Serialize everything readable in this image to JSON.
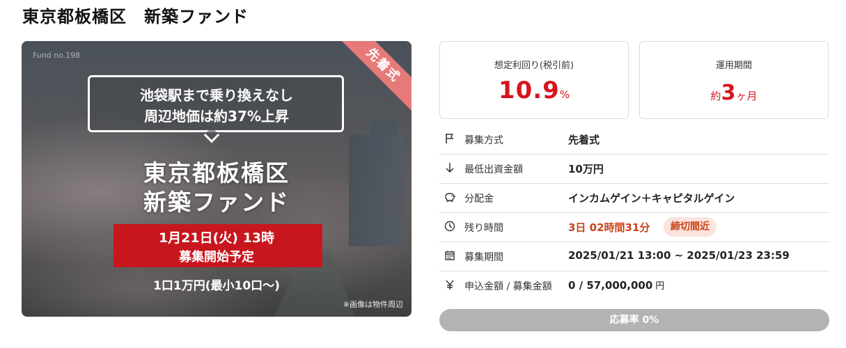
{
  "page": {
    "title": "東京都板橋区　新築ファンド"
  },
  "hero": {
    "fund_no": "Fund no.198",
    "ribbon": "先着式",
    "bubble_line1": "池袋駅まで乗り換えなし",
    "bubble_line2": "周辺地価は約37%上昇",
    "title_line1": "東京都板橋区",
    "title_line2": "新築ファンド",
    "red_line1": "1月21日(火) 13時",
    "red_line2": "募集開始予定",
    "unit_line": "1口1万円(最小10口〜)",
    "note": "※画像は物件周辺"
  },
  "metrics": {
    "yield": {
      "label": "想定利回り(税引前)",
      "value": "10.9",
      "unit": "%"
    },
    "period": {
      "label": "運用期間",
      "prefix": "約",
      "value": "3",
      "unit": "ヶ月"
    }
  },
  "info": {
    "rows": [
      {
        "icon": "flag-icon",
        "label": "募集方式",
        "value": "先着式"
      },
      {
        "icon": "arrow-down-icon",
        "label": "最低出資金額",
        "value": "10万円"
      },
      {
        "icon": "piggy-bank-icon",
        "label": "分配金",
        "value": "インカムゲイン＋キャピタルゲイン"
      },
      {
        "icon": "clock-icon",
        "label": "残り時間",
        "value": "3日 02時間31分",
        "badge": "締切間近"
      },
      {
        "icon": "calendar-icon",
        "label": "募集期間",
        "value": "2025/01/21 13:00 ~ 2025/01/23 23:59"
      },
      {
        "icon": "yen-icon",
        "label": "申込金額 / 募集金額",
        "value": "0 / 57,000,000",
        "unit": "円"
      }
    ]
  },
  "progress": {
    "label": "応募率 0%",
    "percent": 0
  },
  "colors": {
    "accent": "#d7141d",
    "warning": "#c9421a",
    "badge_bg": "#fbe3de",
    "progress_track": "#b3b3b3"
  }
}
